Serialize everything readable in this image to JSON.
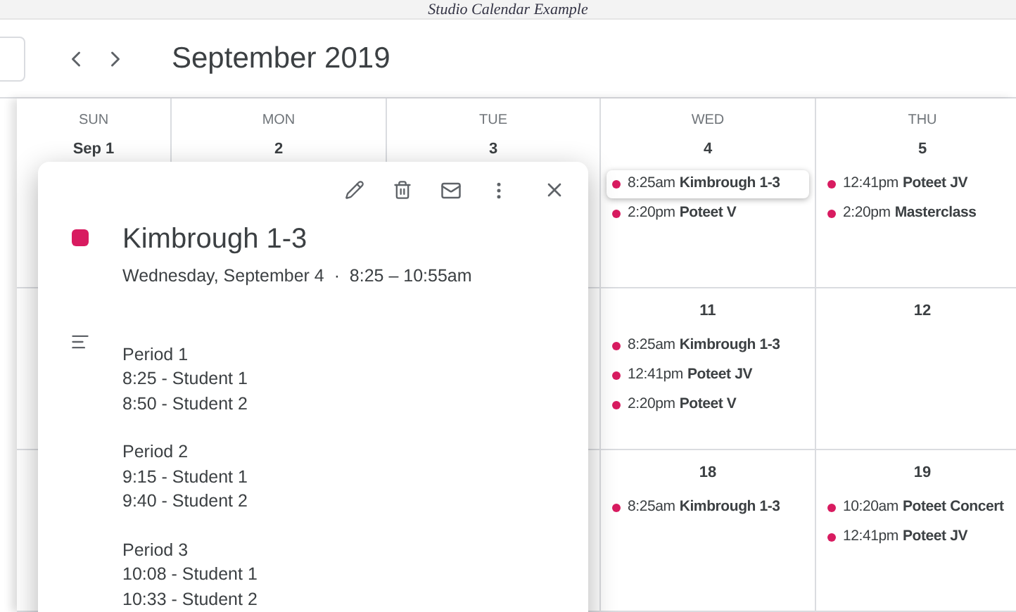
{
  "page_title": "Studio Calendar Example",
  "toolbar": {
    "month_title": "September 2019"
  },
  "calendar": {
    "day_names": [
      "SUN",
      "MON",
      "TUE",
      "WED",
      "THU"
    ],
    "weeks": [
      {
        "days": [
          {
            "date": "Sep 1"
          },
          {
            "date": "2"
          },
          {
            "date": "3"
          },
          {
            "date": "4",
            "events": [
              {
                "time": "8:25am",
                "name": "Kimbrough 1-3",
                "color": "#d81b60",
                "selected": true
              },
              {
                "time": "2:20pm",
                "name": "Poteet V",
                "color": "#d81b60",
                "selected": false
              }
            ]
          },
          {
            "date": "5",
            "events": [
              {
                "time": "12:41pm",
                "name": "Poteet JV",
                "color": "#d81b60",
                "selected": false
              },
              {
                "time": "2:20pm",
                "name": "Masterclass",
                "color": "#d81b60",
                "selected": false
              }
            ]
          }
        ]
      },
      {
        "days": [
          {
            "date": "11",
            "events": [
              {
                "time": "8:25am",
                "name": "Kimbrough 1-3",
                "color": "#d81b60",
                "selected": false
              },
              {
                "time": "12:41pm",
                "name": "Poteet JV",
                "color": "#d81b60",
                "selected": false
              },
              {
                "time": "2:20pm",
                "name": "Poteet V",
                "color": "#d81b60",
                "selected": false
              }
            ]
          },
          {
            "date": "12"
          }
        ]
      },
      {
        "days": [
          {
            "date": "18",
            "events": [
              {
                "time": "8:25am",
                "name": "Kimbrough 1-3",
                "color": "#d81b60",
                "selected": false
              }
            ]
          },
          {
            "date": "19",
            "events": [
              {
                "time": "10:20am",
                "name": "Poteet Concert",
                "color": "#d81b60",
                "selected": false
              },
              {
                "time": "12:41pm",
                "name": "Poteet JV",
                "color": "#d81b60",
                "selected": false
              }
            ]
          }
        ]
      }
    ]
  },
  "event_popup": {
    "title": "Kimbrough 1-3",
    "color": "#d81b60",
    "when": "Wednesday, September 4  ·  8:25 – 10:55am",
    "description": [
      [
        "Period 1",
        "8:25 - Student 1",
        "8:50 - Student 2"
      ],
      [
        "Period 2",
        "9:15 - Student 1",
        "9:40 - Student 2"
      ],
      [
        "Period 3",
        "10:08 - Student 1",
        "10:33 - Student 2"
      ]
    ]
  }
}
